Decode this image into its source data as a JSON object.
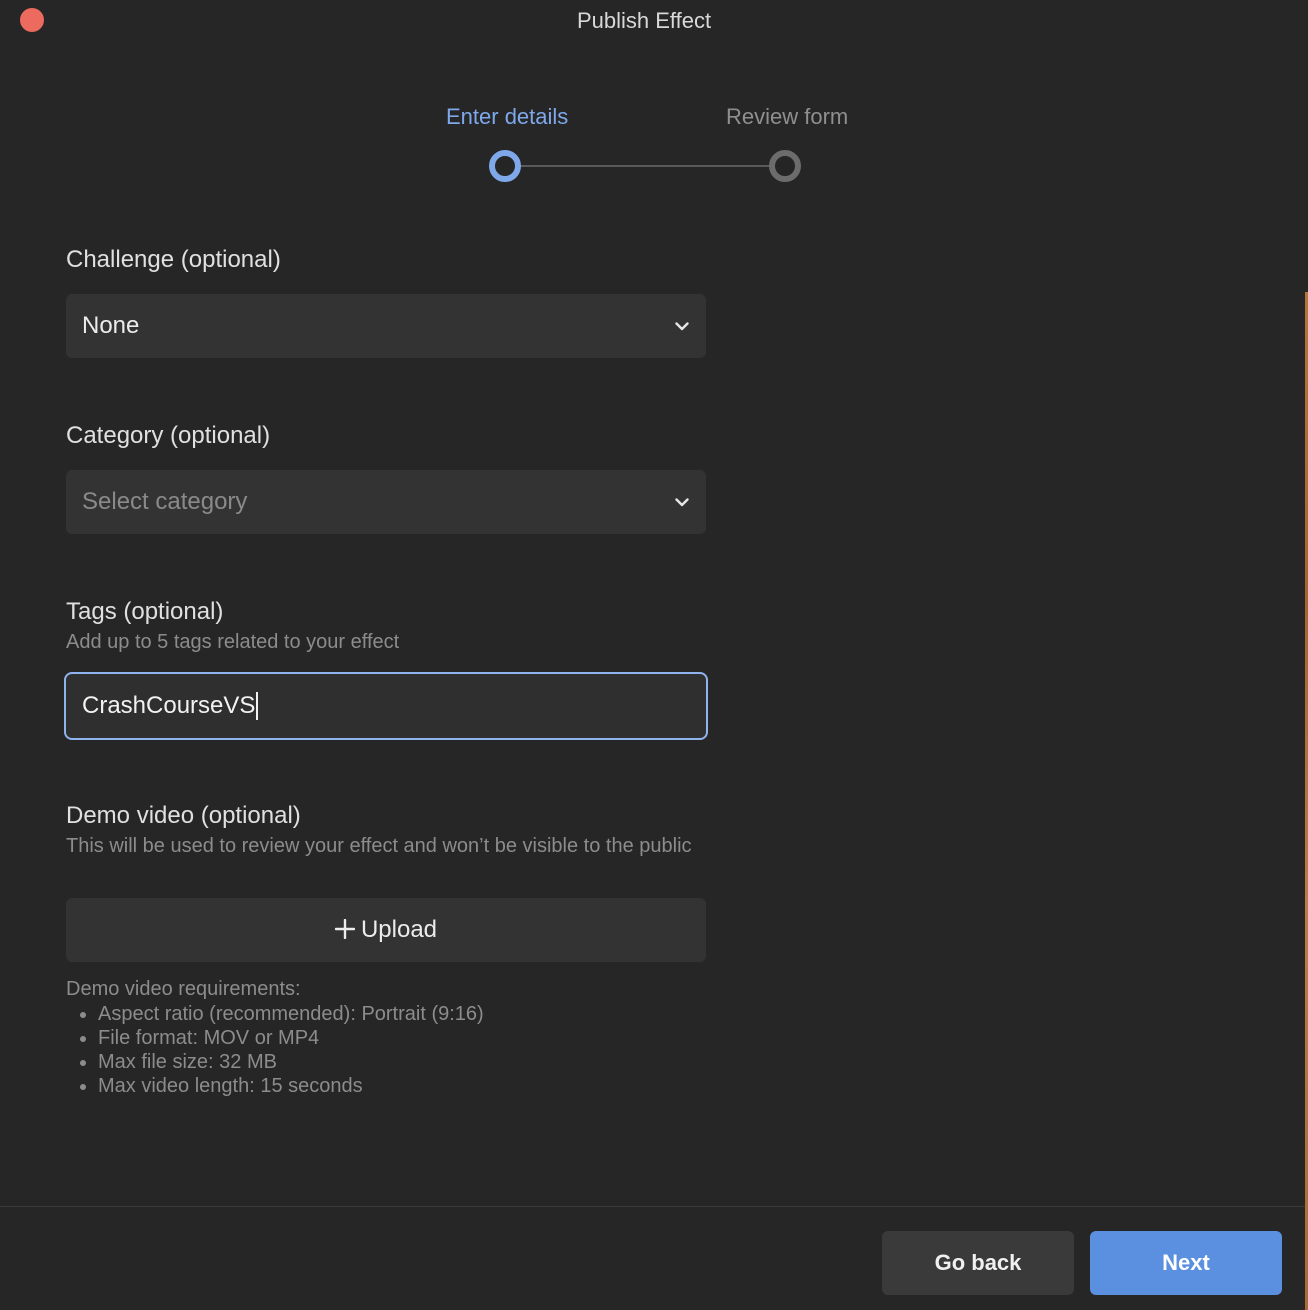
{
  "window": {
    "title": "Publish Effect"
  },
  "stepper": {
    "steps": [
      {
        "label": "Enter details",
        "state": "active"
      },
      {
        "label": "Review form",
        "state": "inactive"
      }
    ]
  },
  "challenge": {
    "label": "Challenge (optional)",
    "value": "None"
  },
  "category": {
    "label": "Category (optional)",
    "placeholder": "Select category"
  },
  "tags": {
    "label": "Tags (optional)",
    "help": "Add up to 5 tags related to your effect",
    "value": "CrashCourseVS"
  },
  "demo_video": {
    "label": "Demo video (optional)",
    "help": "This will be used to review your effect and won’t be visible to the public",
    "upload_label": "Upload",
    "requirements_title": "Demo video requirements:",
    "requirements": [
      "Aspect ratio (recommended): Portrait (9:16)",
      "File format: MOV or MP4",
      "Max file size: 32 MB",
      "Max video length: 15 seconds"
    ]
  },
  "footer": {
    "back_label": "Go back",
    "next_label": "Next"
  },
  "colors": {
    "accent": "#5b8fe0",
    "active_step": "#7ea8ea",
    "close": "#ec6a5e",
    "background": "#262626"
  }
}
